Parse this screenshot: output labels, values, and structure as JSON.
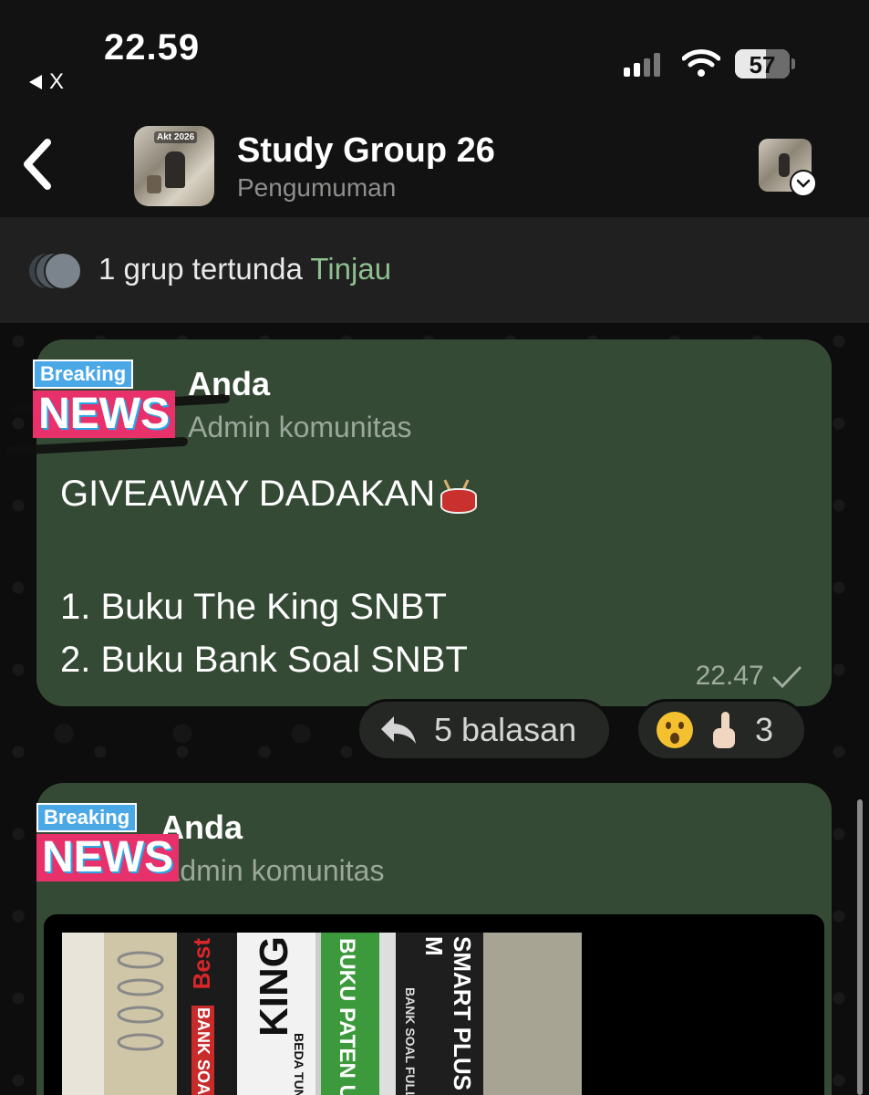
{
  "status_bar": {
    "time": "22.59",
    "back_app_label": "X",
    "battery_level": "57",
    "battery_fraction": 0.57
  },
  "header": {
    "title": "Study Group 26",
    "subtitle": "Pengumuman",
    "avatar_caption": "Akt 2026"
  },
  "pending_banner": {
    "text": "1 grup tertunda",
    "link": "Tinjau"
  },
  "messages": [
    {
      "badge_small": "Breaking",
      "badge_big": "NEWS",
      "sender": "Anda",
      "role": "Admin komunitas",
      "line1": "GIVEAWAY DADAKAN",
      "line2": "1. Buku The King SNBT",
      "line3": "2. Buku Bank Soal SNBT",
      "time": "22.47",
      "replies": "5 balasan",
      "reaction_count": "3"
    },
    {
      "badge_small": "Breaking",
      "badge_big": "NEWS",
      "sender": "Anda",
      "role": "Admin komunitas",
      "photo_text": {
        "book1": "Best",
        "book1b": "BANK SOAL",
        "book2": "KING",
        "book2b": "BEDA TUNT",
        "book3": "BUKU PATEN UTE",
        "book4": "SMART PLUS INTI M",
        "book4b": "BANK SOAL FULL"
      }
    }
  ],
  "colors": {
    "bubble": "#354a35",
    "link": "#8fbf8f",
    "badge_blue": "#4aa8e6",
    "badge_pink": "#e8306a"
  },
  "icons": [
    "back-chevron-icon",
    "signal-icon",
    "wifi-icon",
    "battery-icon",
    "reply-arrow-icon",
    "checkmark-icon",
    "chevron-down-icon"
  ]
}
